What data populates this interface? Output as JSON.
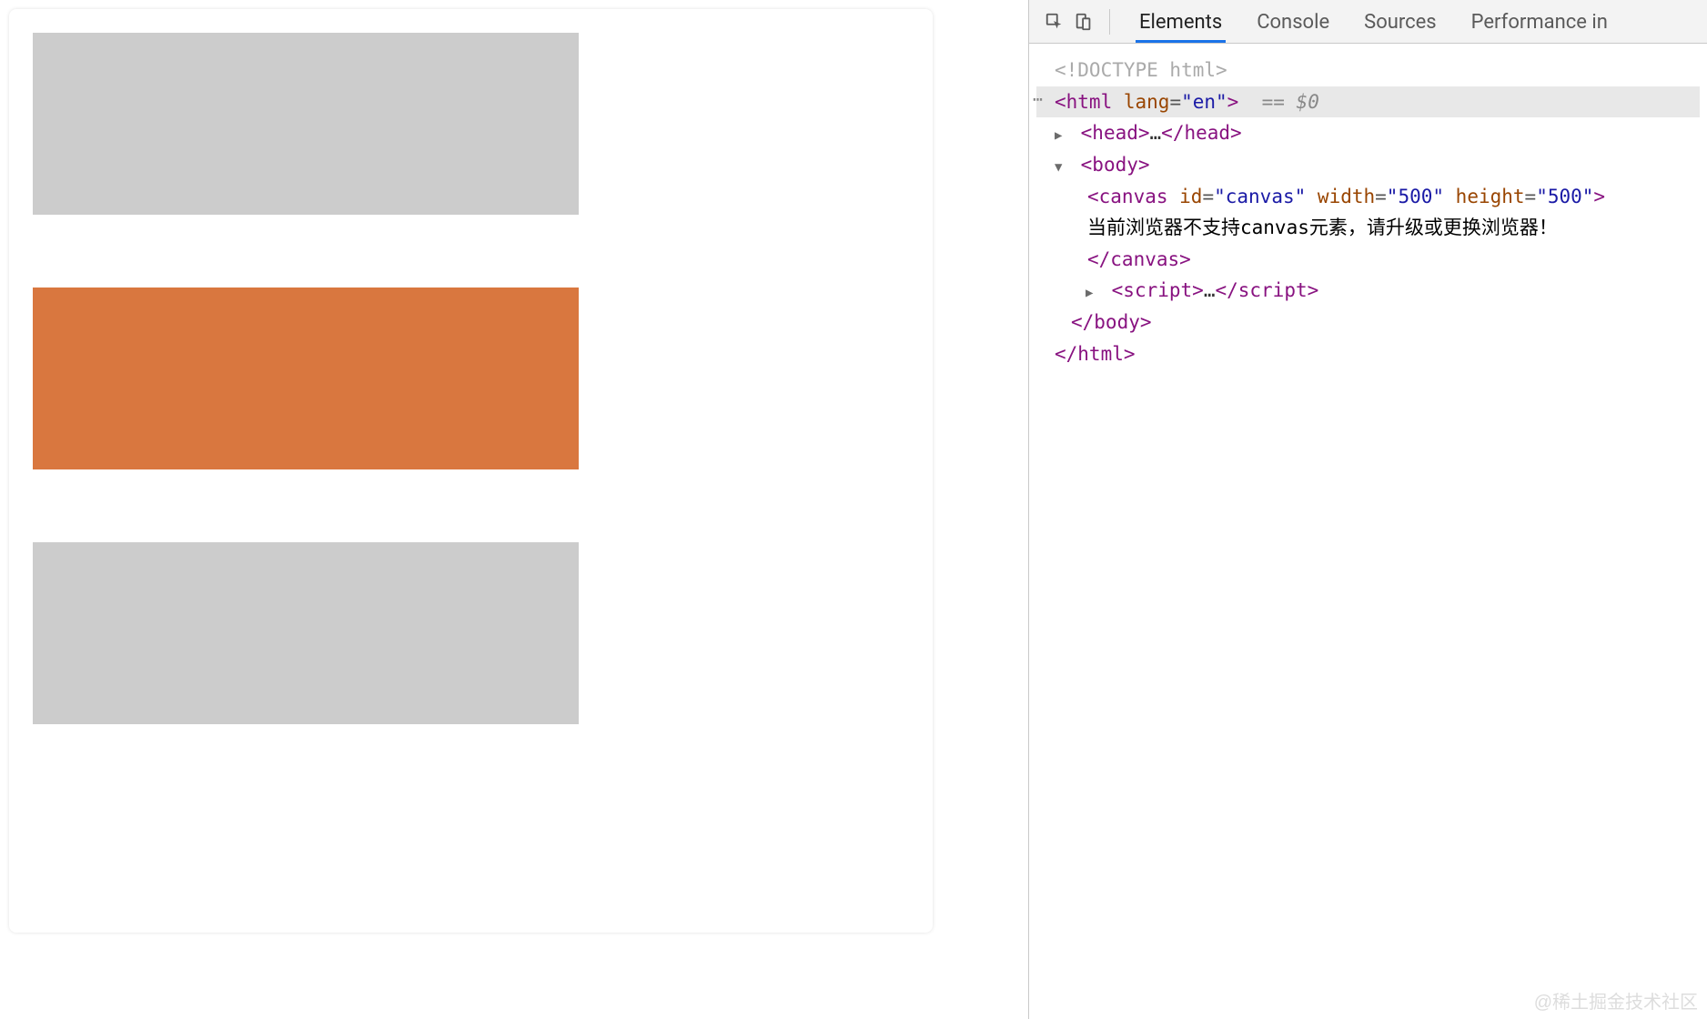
{
  "tabs": {
    "elements": "Elements",
    "console": "Console",
    "sources": "Sources",
    "performance": "Performance in"
  },
  "dom": {
    "doctype": "<!DOCTYPE html>",
    "html_open_prefix": "<html ",
    "html_lang_attr": "lang",
    "html_lang_value": "\"en\"",
    "html_open_suffix": ">",
    "selected_note": "== $0",
    "head_open": "<head>",
    "ellipsis": "…",
    "head_close": "</head>",
    "body_open": "<body>",
    "canvas_open_prefix": "<canvas ",
    "canvas_id_attr": "id",
    "canvas_id_value": "\"canvas\"",
    "canvas_width_attr": "width",
    "canvas_width_value": "\"500\"",
    "canvas_height_attr": "height",
    "canvas_height_value": "\"500\"",
    "canvas_open_suffix": ">",
    "canvas_fallback": "当前浏览器不支持canvas元素，请升级或更换浏览器！",
    "canvas_close": "</canvas>",
    "script_open": "<script>",
    "script_close": "</script>",
    "body_close": "</body>",
    "html_close": "</html>"
  },
  "watermark": "@稀土掘金技术社区",
  "canvas_rects": {
    "colors": {
      "gray": "#cccccc",
      "orange": "#d9773f"
    }
  }
}
